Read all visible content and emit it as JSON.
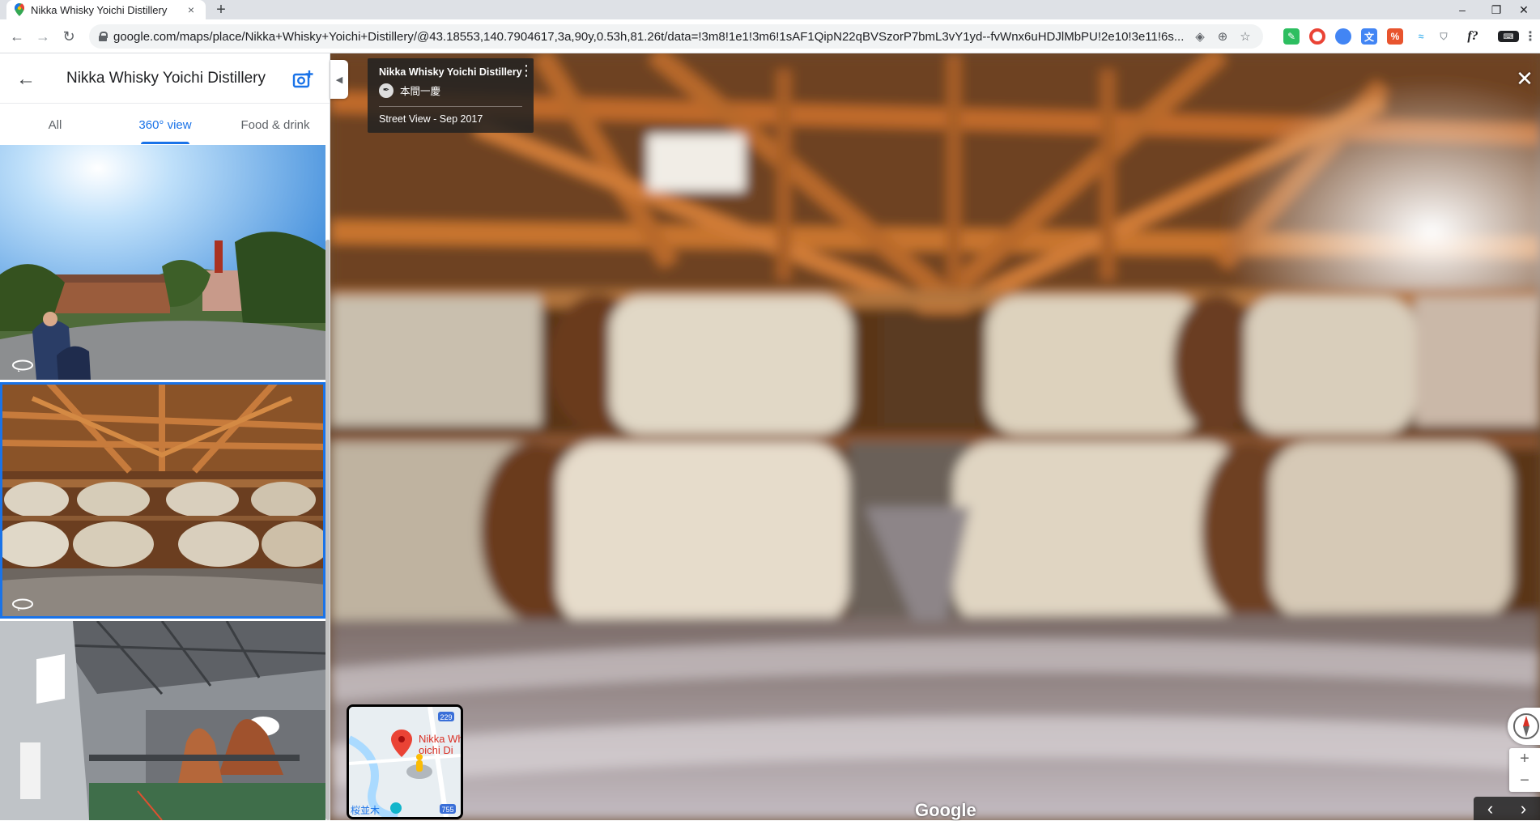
{
  "browser": {
    "tab_title": "Nikka Whisky Yoichi Distillery",
    "tab_close": "×",
    "new_tab": "+",
    "url": "google.com/maps/place/Nikka+Whisky+Yoichi+Distillery/@43.18553,140.7904617,3a,90y,0.53h,81.26t/data=!3m8!1e1!3m6!1sAF1QipN22qBVSzorP7bmL3vY1yd--fvWnx6uHDJlMbPU!2e10!3e11!6s...",
    "window_controls": [
      "–",
      "❐",
      "✕"
    ],
    "nav": {
      "back": "←",
      "forward": "→",
      "reload": "↻"
    },
    "extension_icons": [
      "evernote-icon",
      "chrome-icon",
      "chrome-icon-2",
      "translate-icon",
      "pocket-icon",
      "ai-icon",
      "shield-icon",
      "formula-icon",
      "keyboard-icon",
      "more-icon"
    ]
  },
  "panel": {
    "back_arrow": "←",
    "title": "Nikka Whisky Yoichi Distillery",
    "tabs": [
      {
        "label": "All",
        "active": false
      },
      {
        "label": "360° view",
        "active": true
      },
      {
        "label": "Food & drink",
        "active": false
      }
    ],
    "thumbnails": [
      {
        "name": "thumb-exterior",
        "selected": false
      },
      {
        "name": "thumb-barrel-warehouse",
        "selected": true
      },
      {
        "name": "thumb-still-house",
        "selected": false
      }
    ]
  },
  "viewer": {
    "collapse": "◀",
    "info": {
      "title": "Nikka Whisky Yoichi Distillery",
      "user": "本間一慶",
      "date": "Street View - Sep 2017"
    },
    "close": "✕",
    "minimap": {
      "label_line1": "Nikka Whi",
      "label_line2": "oichi Di",
      "road_229": "229",
      "road_755": "755",
      "place": "桜並木"
    },
    "google_logo": "Google",
    "zoom_in": "+",
    "zoom_out": "−",
    "prev": "‹",
    "next": "›"
  },
  "colors": {
    "accent": "#1a73e8",
    "info_bg": "#222222",
    "map_pin": "#ea4335"
  }
}
